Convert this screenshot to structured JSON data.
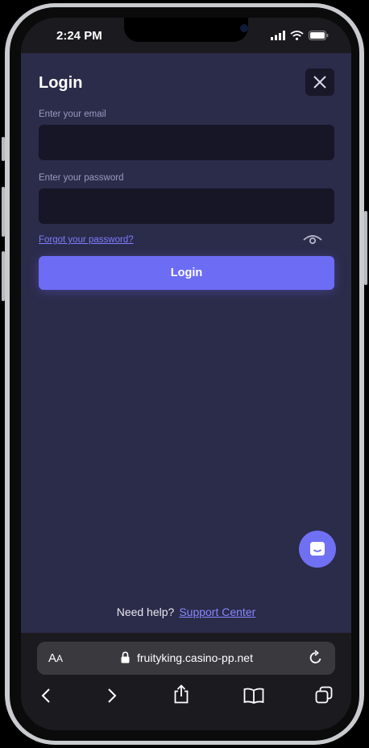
{
  "status_bar": {
    "time": "2:24 PM"
  },
  "login": {
    "title": "Login",
    "email_label": "Enter your email",
    "email_value": "",
    "password_label": "Enter your password",
    "password_value": "",
    "forgot_link": "Forgot your password?",
    "login_button": "Login"
  },
  "help": {
    "text": "Need help?",
    "support_link": "Support Center"
  },
  "browser": {
    "aa_big": "A",
    "aa_small": "A",
    "url": "fruityking.casino-pp.net"
  },
  "colors": {
    "page_bg": "#2b2b4a",
    "accent": "#6c6cf5",
    "input_bg": "#161626",
    "link": "#7d7dff"
  },
  "icons": [
    "close-icon",
    "eye-icon",
    "chat-icon",
    "lock-icon",
    "reload-icon",
    "back-icon",
    "forward-icon",
    "share-icon",
    "bookmarks-icon",
    "tabs-icon"
  ]
}
